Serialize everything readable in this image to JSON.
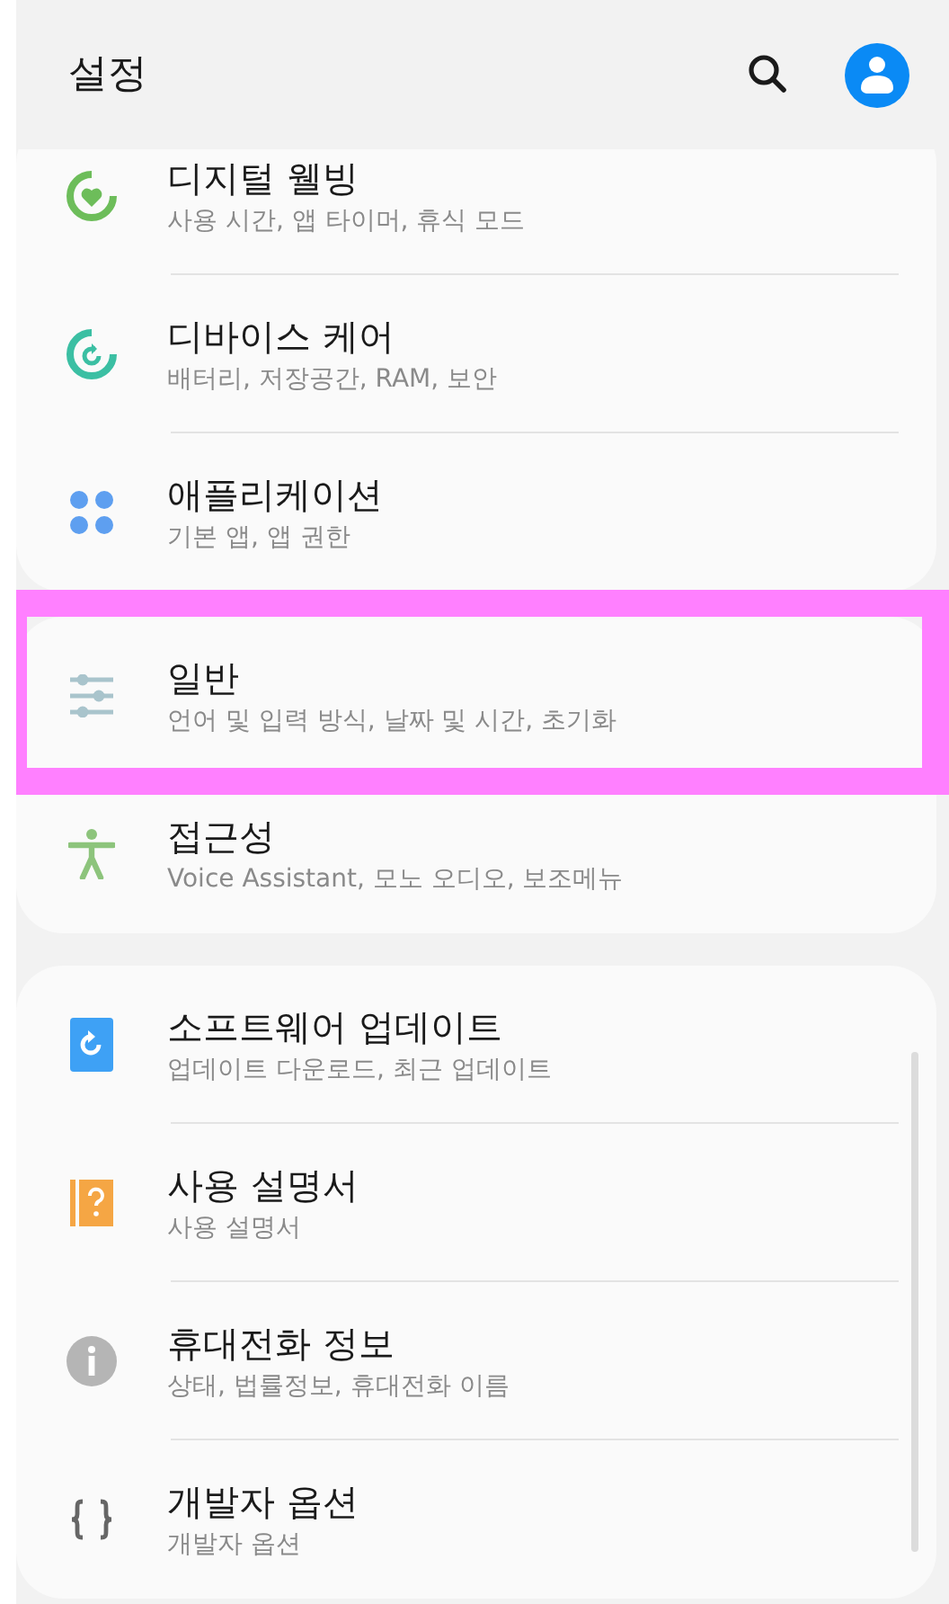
{
  "header": {
    "title": "설정"
  },
  "groups": [
    {
      "items": [
        {
          "kind": "wellbeing",
          "title": "디지털 웰빙",
          "subtitle": "사용 시간, 앱 타이머, 휴식 모드",
          "highlighted": false
        },
        {
          "kind": "device-care",
          "title": "디바이스 케어",
          "subtitle": "배터리, 저장공간, RAM, 보안",
          "highlighted": false
        },
        {
          "kind": "apps",
          "title": "애플리케이션",
          "subtitle": "기본 앱, 앱 권한",
          "highlighted": false
        }
      ]
    },
    {
      "items": [
        {
          "kind": "general",
          "title": "일반",
          "subtitle": "언어 및 입력 방식, 날짜 및 시간, 초기화",
          "highlighted": true
        },
        {
          "kind": "accessibility",
          "title": "접근성",
          "subtitle": "Voice Assistant, 모노 오디오, 보조메뉴",
          "highlighted": false
        }
      ]
    },
    {
      "items": [
        {
          "kind": "update",
          "title": "소프트웨어 업데이트",
          "subtitle": "업데이트 다운로드, 최근 업데이트",
          "highlighted": false
        },
        {
          "kind": "manual",
          "title": "사용 설명서",
          "subtitle": "사용 설명서",
          "highlighted": false
        },
        {
          "kind": "info",
          "title": "휴대전화 정보",
          "subtitle": "상태, 법률정보, 휴대전화 이름",
          "highlighted": false
        },
        {
          "kind": "developer",
          "title": "개발자 옵션",
          "subtitle": "개발자 옵션",
          "highlighted": false
        }
      ]
    }
  ]
}
